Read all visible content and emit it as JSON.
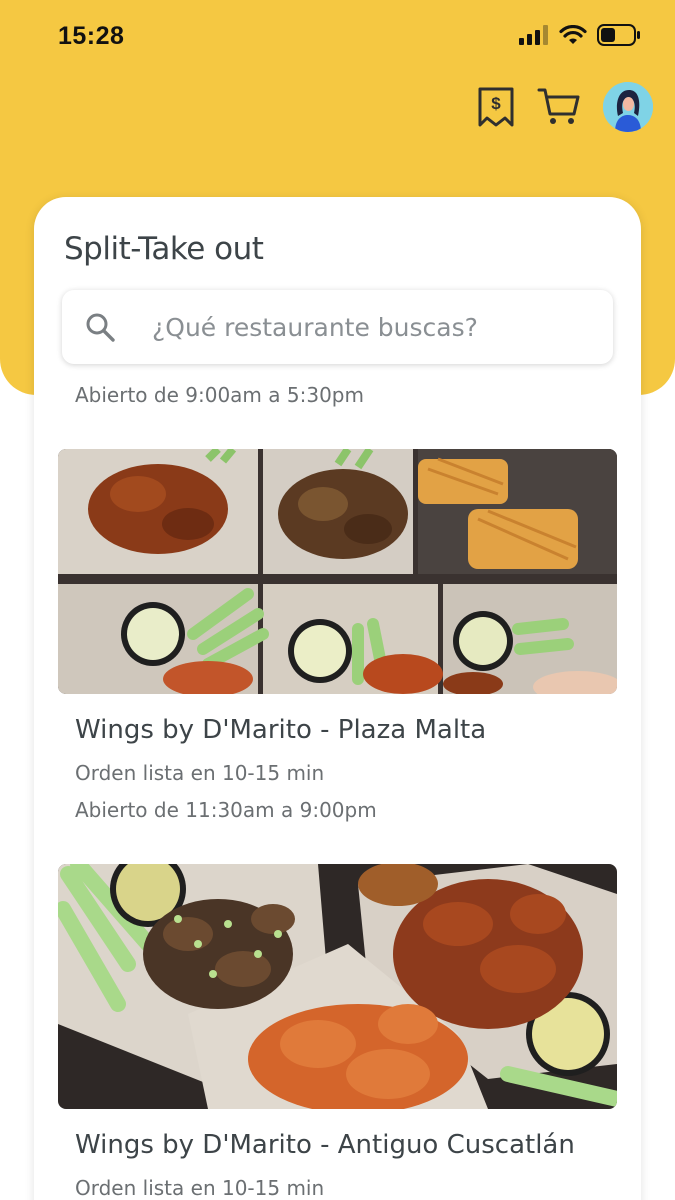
{
  "status_bar": {
    "time": "15:28"
  },
  "header": {
    "icons": [
      "receipt-dollar-icon",
      "cart-icon",
      "avatar"
    ]
  },
  "page": {
    "title": "Split-Take out",
    "search": {
      "placeholder": "¿Qué restaurante buscas?",
      "value": ""
    }
  },
  "restaurants": [
    {
      "hours": "Abierto de 9:00am a 5:30pm"
    },
    {
      "name": "Wings by D'Marito - Plaza Malta",
      "ready": "Orden lista en 10-15 min",
      "hours": "Abierto de 11:30am a 9:00pm",
      "image": "wings-platter-photo"
    },
    {
      "name": "Wings by D'Marito - Antiguo Cuscatlán",
      "ready": "Orden lista en 10-15 min",
      "image": "wings-platter-photo"
    }
  ],
  "colors": {
    "brand_yellow": "#f5c842",
    "text_dark": "#3d4448",
    "text_muted": "#6b6f72"
  }
}
